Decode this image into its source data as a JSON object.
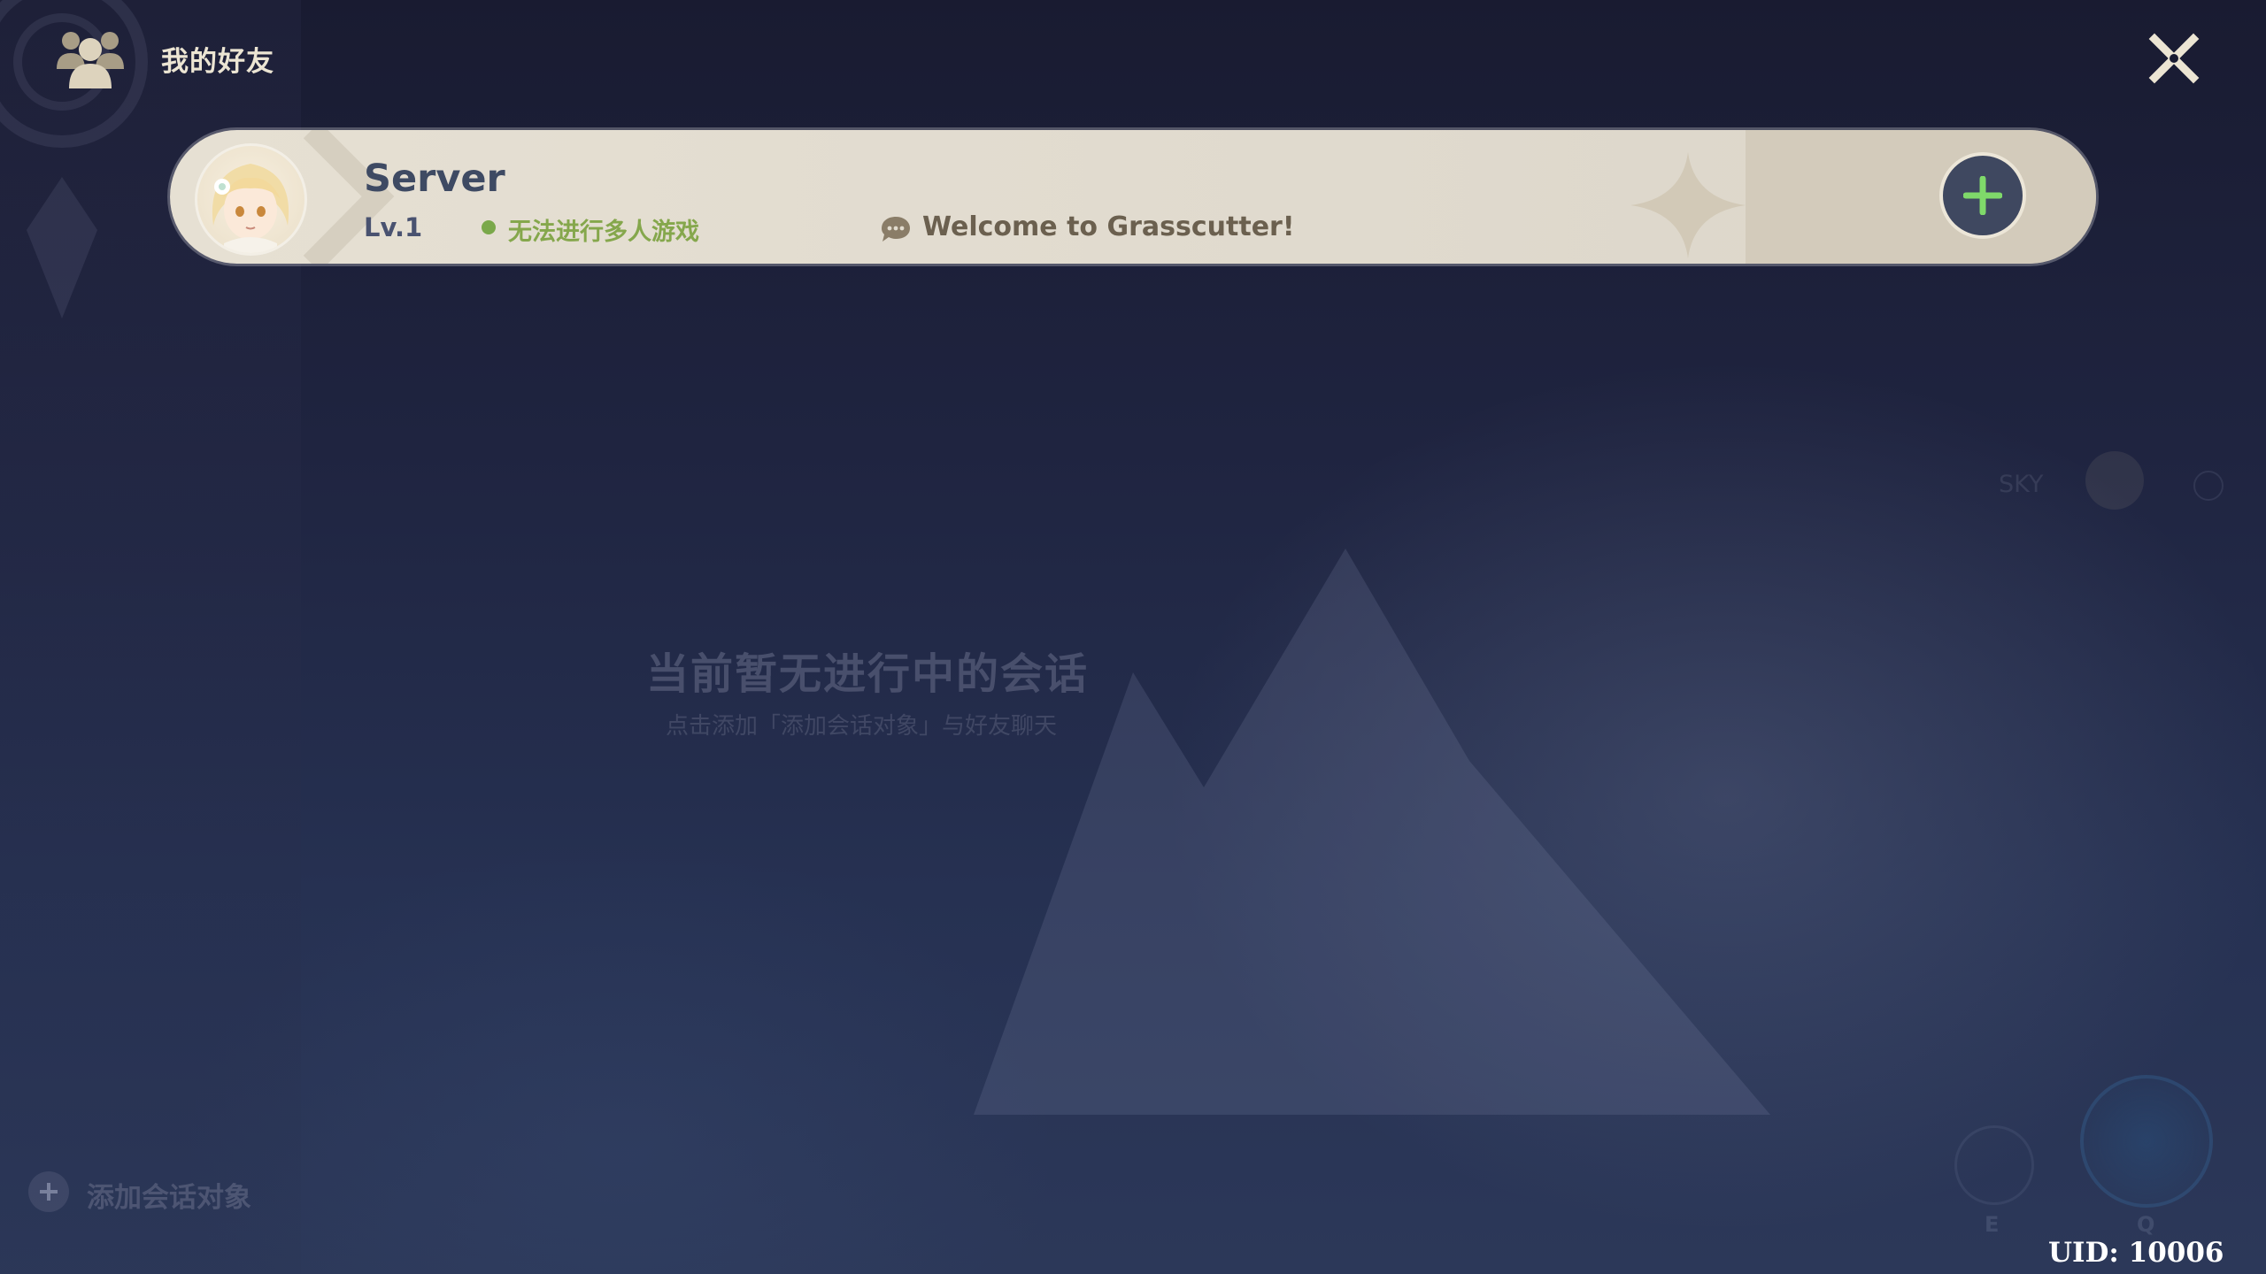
{
  "header": {
    "title": "我的好友",
    "icon": "friends-icon",
    "close_icon": "close-icon"
  },
  "friend_card": {
    "name": "Server",
    "level": "Lv.1",
    "status_text": "无法进行多人游戏",
    "signature": "Welcome to Grasscutter!",
    "add_button_icon": "plus-icon",
    "status_color": "#7aa84a"
  },
  "empty_state": {
    "title": "当前暂无进行中的会话",
    "subtitle": "点击添加「添加会话对象」与好友聊天"
  },
  "add_conversation": {
    "label": "添加会话对象",
    "icon": "plus-icon"
  },
  "hud": {
    "player_tag": "SKY",
    "skill_e_key": "E",
    "skill_q_key": "Q"
  },
  "uid": "UID: 10006",
  "colors": {
    "accent_green": "#7fd96a",
    "card_background": "#e2dccf",
    "name_color": "#3e4a63"
  }
}
